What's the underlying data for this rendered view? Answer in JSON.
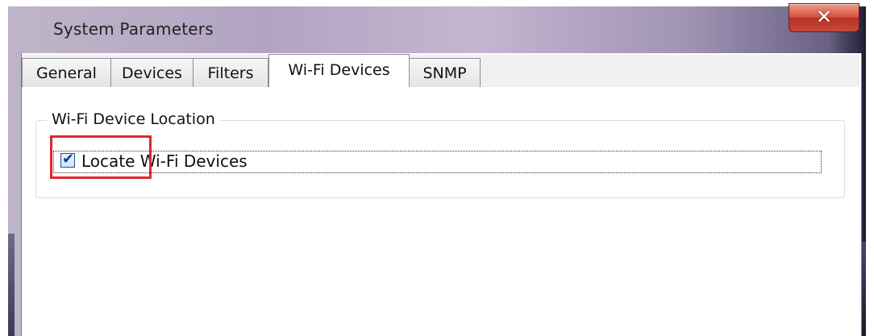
{
  "window": {
    "title": "System Parameters",
    "close_label": "✕"
  },
  "tabs": [
    {
      "label": "General",
      "active": false
    },
    {
      "label": "Devices",
      "active": false
    },
    {
      "label": "Filters",
      "active": false
    },
    {
      "label": "Wi-Fi Devices",
      "active": true
    },
    {
      "label": "SNMP",
      "active": false
    }
  ],
  "wifi_device_location": {
    "group_title": "Wi-Fi Device Location",
    "locate_checkbox": {
      "label": "Locate Wi-Fi Devices",
      "checked": true,
      "check_glyph": "✔"
    }
  },
  "annotation": {
    "highlight_color": "#e2262b"
  }
}
